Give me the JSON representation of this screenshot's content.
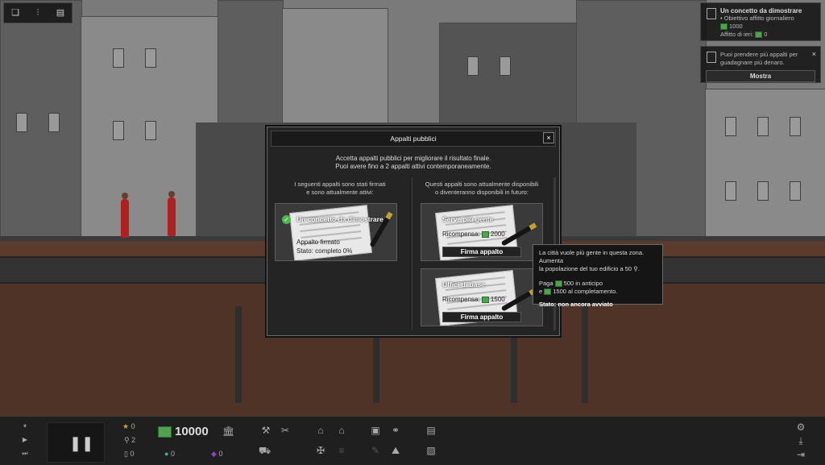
{
  "notifications": [
    {
      "title": "Un concetto da dimostrare",
      "lines": [
        "• Obiettivo affitto giornaliero",
        "1000",
        "Affitto di ieri: ",
        "0"
      ]
    },
    {
      "text": "Puoi prendere più appalti per guadagnare più denaro.",
      "close_label": "×",
      "button_label": "Mostra"
    }
  ],
  "modal": {
    "title": "Appalti pubblici",
    "close_label": "×",
    "intro_line1": "Accetta appalti pubblici per migliorare il risultato finale.",
    "intro_line2": "Puoi avere fino a 2 appalti attivi contemporaneamente.",
    "left_header_line1": "I seguenti appalti sono stati firmati",
    "left_header_line2": "e sono attualmente attivi:",
    "right_header_line1": "Questi appalti sono attualmente disponibili",
    "right_header_line2": "o diventeranno disponibili in futuro:",
    "active_contract": {
      "title": "Un concetto da dimostrare",
      "status1": "Appalto firmato",
      "status2": "Stato: completo 0%"
    },
    "available": [
      {
        "title": "Serve più gente",
        "reward_label": "Ricompensa:",
        "reward": "2000",
        "button": "Firma appalto"
      },
      {
        "title": "Uffici di base",
        "reward_label": "Ricompensa:",
        "reward": "1500",
        "button": "Firma appalto"
      }
    ]
  },
  "tooltip": {
    "line1": "La città vuole più gente in questa zona. Aumenta",
    "line2": "la popolazione del tuo edificio a 50",
    "pay_label": "Paga",
    "upfront": "500",
    "upfront_suffix": "in anticipo",
    "and_label": "e",
    "completion": "1500",
    "completion_suffix": "al completamento.",
    "status": "Stato: non ancora avviato"
  },
  "bottom": {
    "stars": "0",
    "people": "2",
    "rooms": "0",
    "money": "10000",
    "happiness": "0",
    "other": "0"
  },
  "colors": {
    "money_green": "#4fa34f",
    "modal_bg": "#242424",
    "check_green": "#4cb84c"
  }
}
